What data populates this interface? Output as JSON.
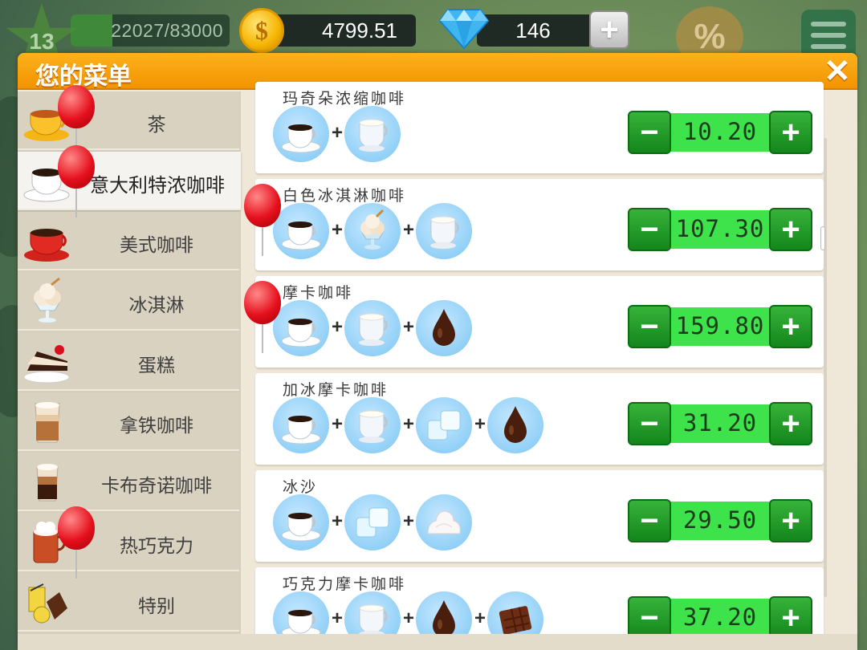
{
  "hud": {
    "level": "13",
    "xp_text": "22027/83000",
    "xp_progress": 0.265,
    "coins": "4799.51",
    "gems": "146",
    "add_gems_label": "+",
    "sale_label": "%"
  },
  "panel": {
    "title": "您的菜单",
    "close_label": "✕"
  },
  "categories": [
    {
      "label": "茶",
      "icon": "tea-cup-icon",
      "balloon": true
    },
    {
      "label": "意大利特浓咖啡",
      "icon": "espresso-cup-icon",
      "balloon": true,
      "active": true
    },
    {
      "label": "美式咖啡",
      "icon": "americano-cup-icon",
      "balloon": false
    },
    {
      "label": "冰淇淋",
      "icon": "ice-cream-icon",
      "balloon": false
    },
    {
      "label": "蛋糕",
      "icon": "cake-slice-icon",
      "balloon": false
    },
    {
      "label": "拿铁咖啡",
      "icon": "latte-glass-icon",
      "balloon": false
    },
    {
      "label": "卡布奇诺咖啡",
      "icon": "cappuccino-glass-icon",
      "balloon": false
    },
    {
      "label": "热巧克力",
      "icon": "hot-chocolate-icon",
      "balloon": true
    },
    {
      "label": "特别",
      "icon": "special-icon",
      "balloon": false
    }
  ],
  "recipes": [
    {
      "name": "玛奇朵浓缩咖啡",
      "price": "10.20",
      "ingredients": [
        "espresso",
        "milk"
      ],
      "balloon": false
    },
    {
      "name": "白色冰淇淋咖啡",
      "price": "107.30",
      "ingredients": [
        "espresso",
        "ice-cream",
        "milk"
      ],
      "balloon": true
    },
    {
      "name": "摩卡咖啡",
      "price": "159.80",
      "ingredients": [
        "espresso",
        "milk",
        "chocolate-syrup"
      ],
      "balloon": true
    },
    {
      "name": "加冰摩卡咖啡",
      "price": "31.20",
      "ingredients": [
        "espresso",
        "milk",
        "ice",
        "chocolate-syrup"
      ],
      "balloon": false
    },
    {
      "name": "冰沙",
      "price": "29.50",
      "ingredients": [
        "espresso",
        "ice",
        "whipped-cream"
      ],
      "balloon": false
    },
    {
      "name": "巧克力摩卡咖啡",
      "price": "37.20",
      "ingredients": [
        "espresso",
        "milk",
        "chocolate-syrup",
        "chocolate-bar"
      ],
      "balloon": false
    }
  ],
  "labels": {
    "plus_sign": "+",
    "minus_btn": "−",
    "plus_btn": "+"
  },
  "colors": {
    "header_orange": "#f39300",
    "price_green": "#3ee24b",
    "button_green": "#14861c",
    "balloon_red": "#e5101d"
  }
}
